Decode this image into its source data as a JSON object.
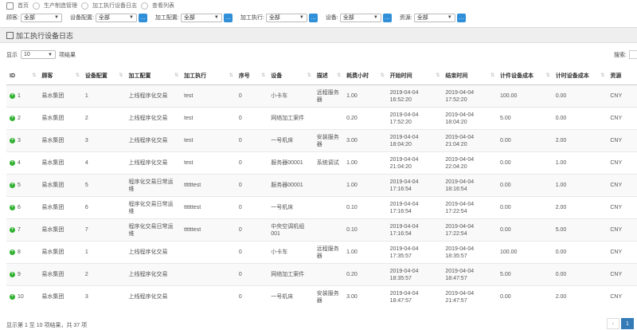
{
  "breadcrumb": [
    "首页",
    "生产制造管理",
    "加工执行设备日志",
    "查看列表"
  ],
  "filters": [
    {
      "label": "顾客:",
      "value": "全部",
      "has_button": false
    },
    {
      "label": "设备配置:",
      "value": "全部",
      "has_button": true
    },
    {
      "label": "加工配置:",
      "value": "全部",
      "has_button": true
    },
    {
      "label": "加工执行:",
      "value": "全部",
      "has_button": true
    },
    {
      "label": "设备:",
      "value": "全部",
      "has_button": true
    },
    {
      "label": "资源:",
      "value": "全部",
      "has_button": true
    }
  ],
  "panel_title": "加工执行设备日志",
  "length": {
    "prefix": "显示",
    "value": "10",
    "suffix": "项结果"
  },
  "search_label": "搜索:",
  "columns": [
    "ID",
    "顾客",
    "设备配置",
    "加工配置",
    "加工执行",
    "序号",
    "设备",
    "描述",
    "耗费小时",
    "开始时间",
    "结束时间",
    "计件设备成本",
    "计时设备成本",
    "资源"
  ],
  "rows": [
    [
      "1",
      "易水集团",
      "1",
      "上线程序化交易",
      "test",
      "0",
      "小卡车",
      "远程服务器",
      "1.00",
      "2019-04-04 16:52:20",
      "2019-04-04 17:52:20",
      "100.00",
      "0.00",
      "CNY"
    ],
    [
      "2",
      "易水集团",
      "2",
      "上线程序化交易",
      "test",
      "0",
      "网络加工案件",
      "",
      "0.20",
      "2019-04-04 17:52:20",
      "2019-04-04 18:04:20",
      "5.00",
      "0.00",
      "CNY"
    ],
    [
      "3",
      "易水集团",
      "3",
      "上线程序化交易",
      "test",
      "0",
      "一号机床",
      "安装服务器",
      "3.00",
      "2019-04-04 18:04:20",
      "2019-04-04 21:04:20",
      "0.00",
      "2.00",
      "CNY"
    ],
    [
      "4",
      "易水集团",
      "4",
      "上线程序化交易",
      "test",
      "0",
      "服务器00001",
      "系统调试",
      "1.00",
      "2019-04-04 21:04:20",
      "2019-04-04 22:04:20",
      "0.00",
      "1.00",
      "CNY"
    ],
    [
      "5",
      "易水集团",
      "5",
      "程序化交易日常运维",
      "ttttttest",
      "0",
      "服务器00001",
      "",
      "1.00",
      "2019-04-04 17:16:54",
      "2019-04-04 18:16:54",
      "0.00",
      "1.00",
      "CNY"
    ],
    [
      "6",
      "易水集团",
      "6",
      "程序化交易日常运维",
      "ttttttest",
      "0",
      "一号机床",
      "",
      "0.10",
      "2019-04-04 17:16:54",
      "2019-04-04 17:22:54",
      "0.00",
      "2.00",
      "CNY"
    ],
    [
      "7",
      "易水集团",
      "7",
      "程序化交易日常运维",
      "ttttttest",
      "0",
      "中央空调机组001",
      "",
      "0.10",
      "2019-04-04 17:16:54",
      "2019-04-04 17:22:54",
      "0.00",
      "5.00",
      "CNY"
    ],
    [
      "8",
      "易水集团",
      "1",
      "上线程序化交易",
      "",
      "0",
      "小卡车",
      "远程服务器",
      "1.00",
      "2019-04-04 17:35:57",
      "2019-04-04 18:35:57",
      "100.00",
      "0.00",
      "CNY"
    ],
    [
      "9",
      "易水集团",
      "2",
      "上线程序化交易",
      "",
      "0",
      "网络加工案件",
      "",
      "0.20",
      "2019-04-04 18:35:57",
      "2019-04-04 18:47:57",
      "5.00",
      "0.00",
      "CNY"
    ],
    [
      "10",
      "易水集团",
      "3",
      "上线程序化交易",
      "",
      "0",
      "一号机床",
      "安装服务器",
      "3.00",
      "2019-04-04 18:47:57",
      "2019-04-04 21:47:57",
      "0.00",
      "2.00",
      "CNY"
    ]
  ],
  "info": "显示第 1 至 10 项结果，共 37 项",
  "pager": {
    "prev": "‹",
    "current": "1"
  },
  "colors": {
    "accent": "#2f8fd8",
    "page_active": "#337ab7",
    "expand": "#31b131"
  }
}
